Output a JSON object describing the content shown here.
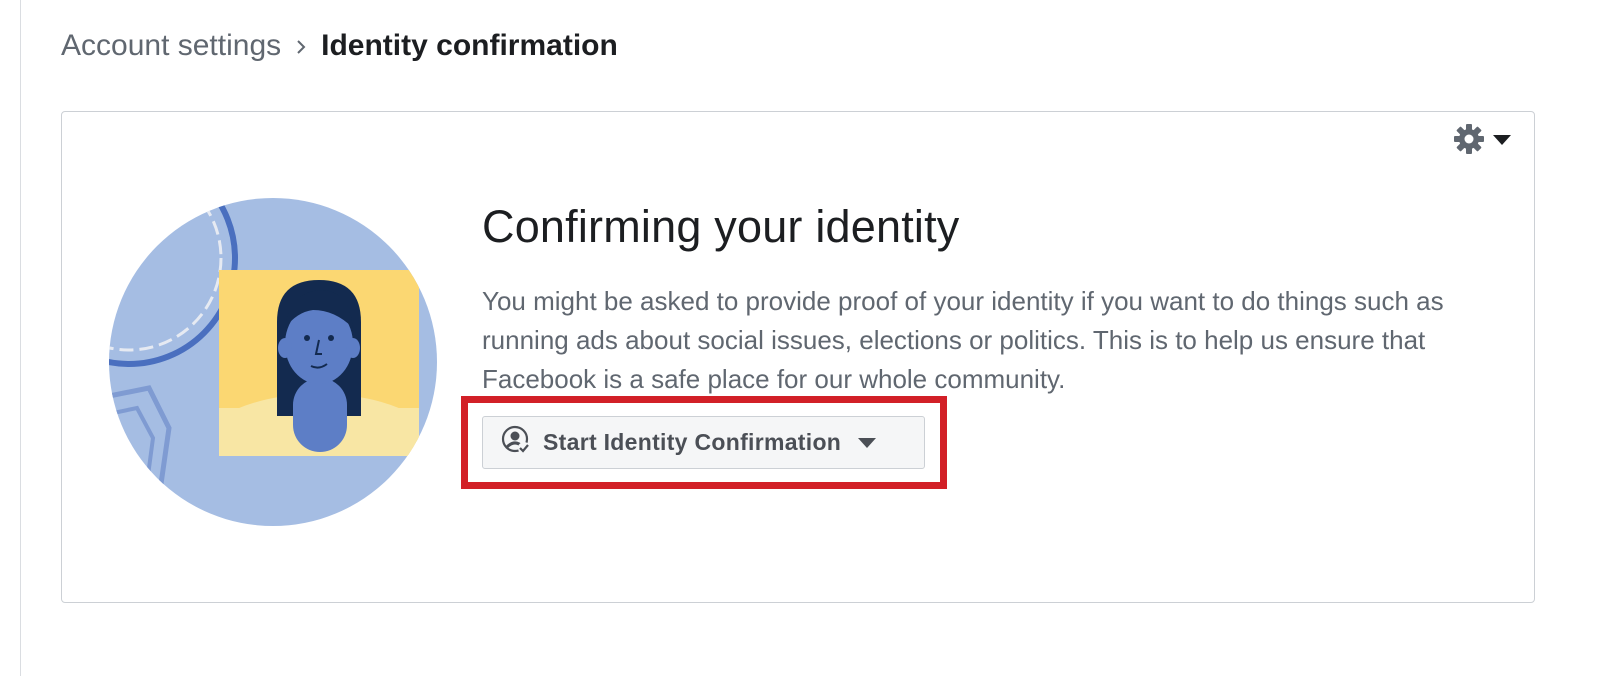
{
  "breadcrumb": {
    "parent": "Account settings",
    "separator_icon": "chevron-right-icon",
    "current": "Identity confirmation"
  },
  "card": {
    "menu_icons": [
      "gear-icon",
      "caret-down-icon"
    ],
    "illustration": "person-id-illustration",
    "title": "Confirming your identity",
    "description": "You might be asked to provide proof of your identity if you want to do things such as running ads about social issues, elections or politics. This is to help us ensure that Facebook is a safe place for our whole community.",
    "start_button": {
      "label": "Start Identity Confirmation",
      "icon": "user-check-icon",
      "caret_icon": "caret-down-icon"
    }
  },
  "colors": {
    "highlight": "#d22027",
    "text_primary": "#1c1e21",
    "text_secondary": "#606770",
    "illustration_blue": "#a5bde3",
    "illustration_yellow": "#fbd772"
  }
}
